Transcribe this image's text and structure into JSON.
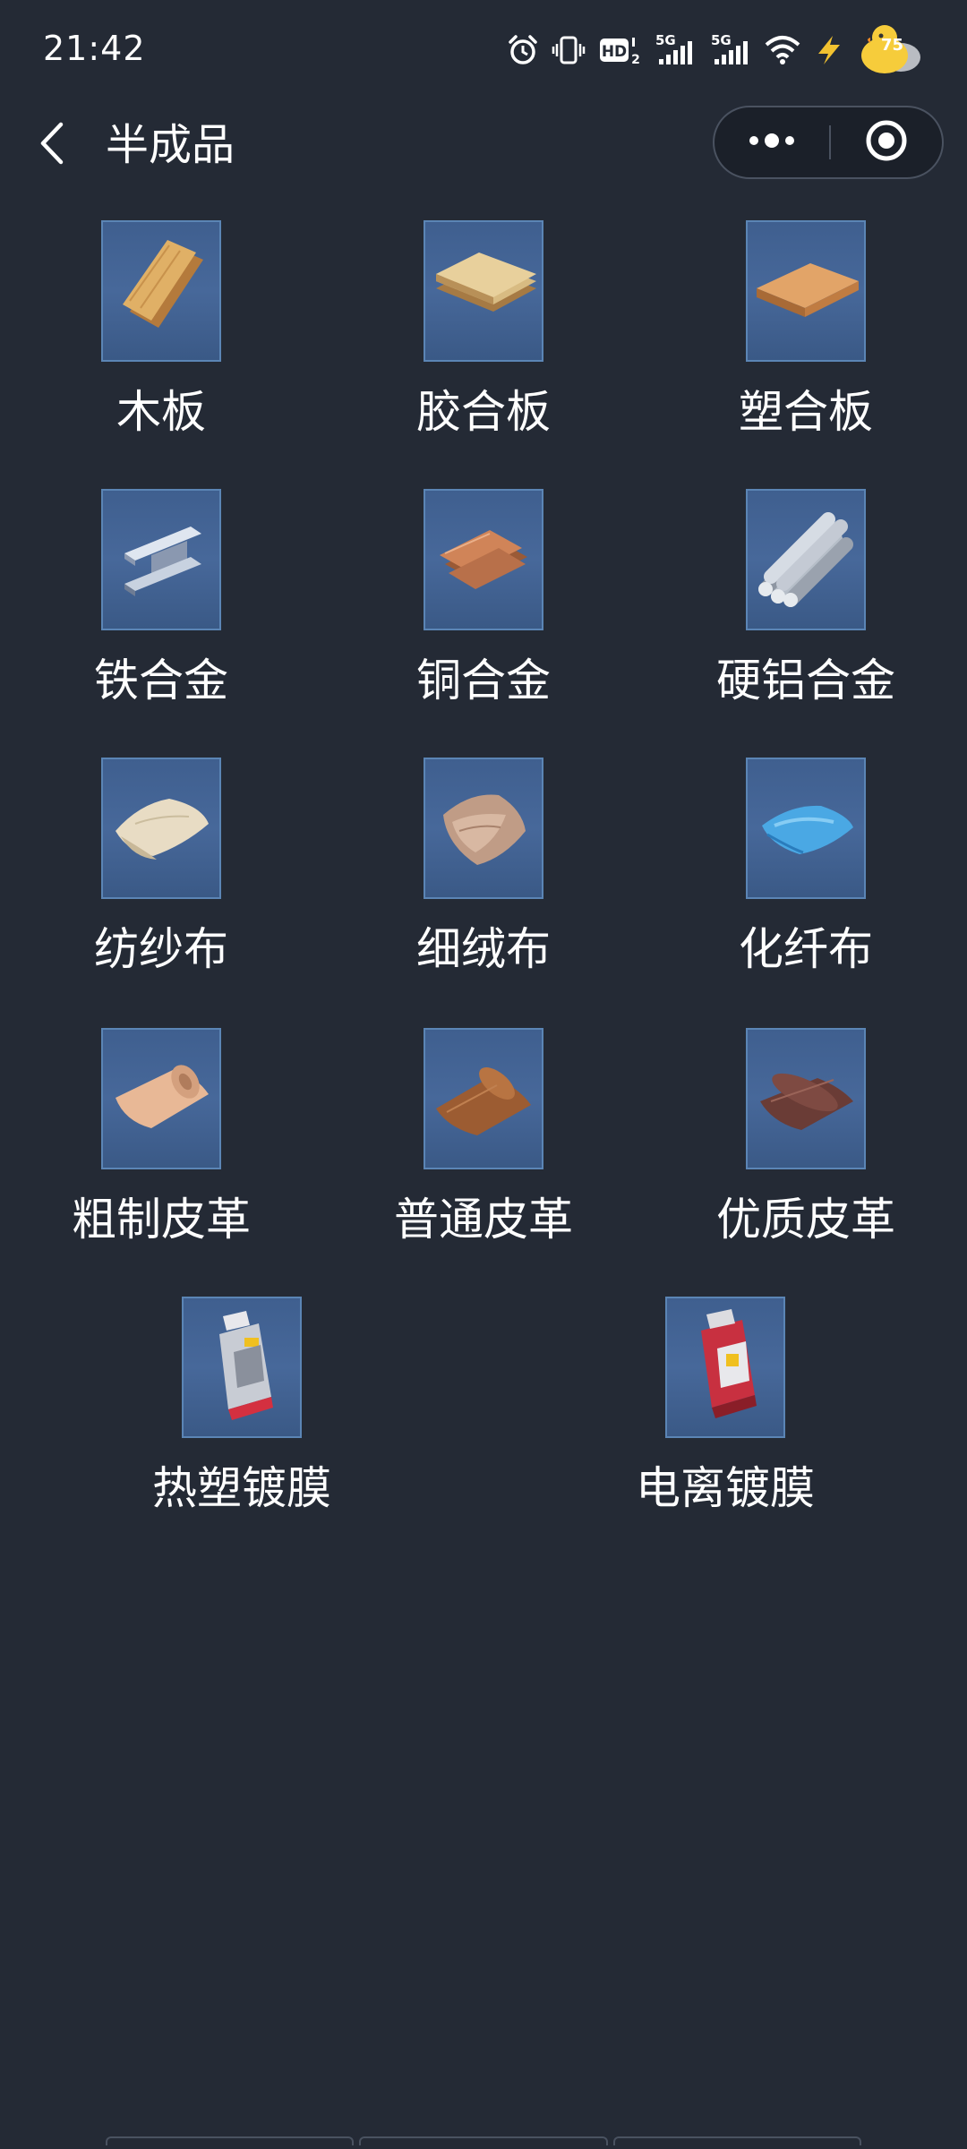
{
  "status_bar": {
    "time": "21:42",
    "network_1": "5G",
    "network_2": "5G",
    "hd_label": "HD",
    "hd_sub": "2",
    "battery_level": "75",
    "icons": [
      "alarm-icon",
      "vibrate-icon",
      "hd-icon",
      "signal-icon",
      "signal-icon",
      "wifi-icon",
      "charging-icon",
      "battery-duck-icon"
    ]
  },
  "nav": {
    "title": "半成品",
    "back_icon": "chevron-left-icon",
    "more_icon": "more-dots-icon",
    "close_icon": "target-circle-icon"
  },
  "colors": {
    "background": "#242a35",
    "icon_tile": "#45669a",
    "icon_border": "#5b85b5",
    "text": "#ffffff"
  },
  "items": [
    {
      "label": "木板",
      "icon": "wood-plank-icon"
    },
    {
      "label": "胶合板",
      "icon": "plywood-icon"
    },
    {
      "label": "塑合板",
      "icon": "particleboard-icon"
    },
    {
      "label": "铁合金",
      "icon": "iron-beam-icon"
    },
    {
      "label": "铜合金",
      "icon": "copper-sheet-icon"
    },
    {
      "label": "硬铝合金",
      "icon": "aluminum-rods-icon"
    },
    {
      "label": "纺纱布",
      "icon": "cotton-cloth-icon"
    },
    {
      "label": "细绒布",
      "icon": "fine-cloth-icon"
    },
    {
      "label": "化纤布",
      "icon": "synthetic-cloth-icon"
    },
    {
      "label": "粗制皮革",
      "icon": "rough-leather-icon"
    },
    {
      "label": "普通皮革",
      "icon": "leather-icon"
    },
    {
      "label": "优质皮革",
      "icon": "fine-leather-icon"
    },
    {
      "label": "热塑镀膜",
      "icon": "thermoplastic-coating-icon"
    },
    {
      "label": "电离镀膜",
      "icon": "ionized-coating-icon"
    }
  ]
}
